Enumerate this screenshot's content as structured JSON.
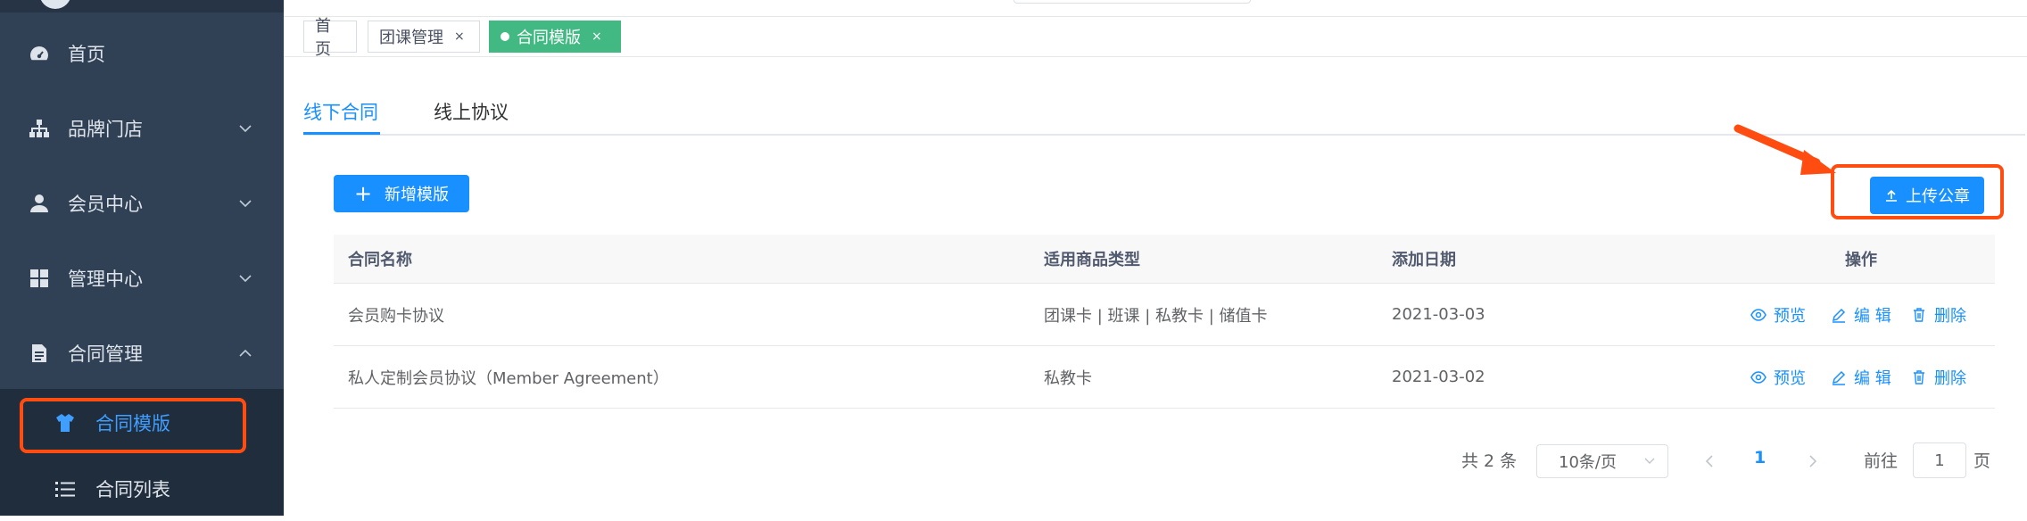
{
  "sidebar": {
    "items": [
      {
        "label": "首页",
        "icon": "dashboard-icon"
      },
      {
        "label": "品牌门店",
        "icon": "org-chart-icon"
      },
      {
        "label": "会员中心",
        "icon": "user-icon"
      },
      {
        "label": "管理中心",
        "icon": "grid-icon"
      },
      {
        "label": "合同管理",
        "icon": "document-icon"
      }
    ],
    "submenu": [
      {
        "label": "合同模版",
        "icon": "shirt-icon",
        "active": true
      },
      {
        "label": "合同列表",
        "icon": "list-icon"
      }
    ]
  },
  "tags": [
    {
      "label": "首页"
    },
    {
      "label": "团课管理",
      "close": "×"
    },
    {
      "label": "合同模版",
      "close": "×",
      "active": true
    }
  ],
  "tabs": [
    {
      "label": "线下合同",
      "active": true
    },
    {
      "label": "线上协议"
    }
  ],
  "toolbar": {
    "add_label": "新增模版",
    "add_icon": "+",
    "upload_label": "上传公章"
  },
  "table": {
    "headers": [
      "合同名称",
      "适用商品类型",
      "添加日期",
      "操作"
    ],
    "rows": [
      {
        "name": "会员购卡协议",
        "types": "团课卡 | 班课 | 私教卡 | 储值卡",
        "date": "2021-03-03"
      },
      {
        "name": "私人定制会员协议（Member Agreement）",
        "types": "私教卡",
        "date": "2021-03-02"
      }
    ],
    "actions": {
      "preview": "预览",
      "edit": "编 辑",
      "delete": "删除"
    }
  },
  "pagination": {
    "total": "共 2 条",
    "page_size": "10条/页",
    "current": "1",
    "goto_label": "前往",
    "goto_value": "1",
    "unit": "页"
  },
  "colors": {
    "sidebar_bg": "#304156",
    "submenu_bg": "#1f2d3d",
    "primary": "#1890ff",
    "active_tag": "#42b983",
    "highlight": "#ff4d12"
  }
}
